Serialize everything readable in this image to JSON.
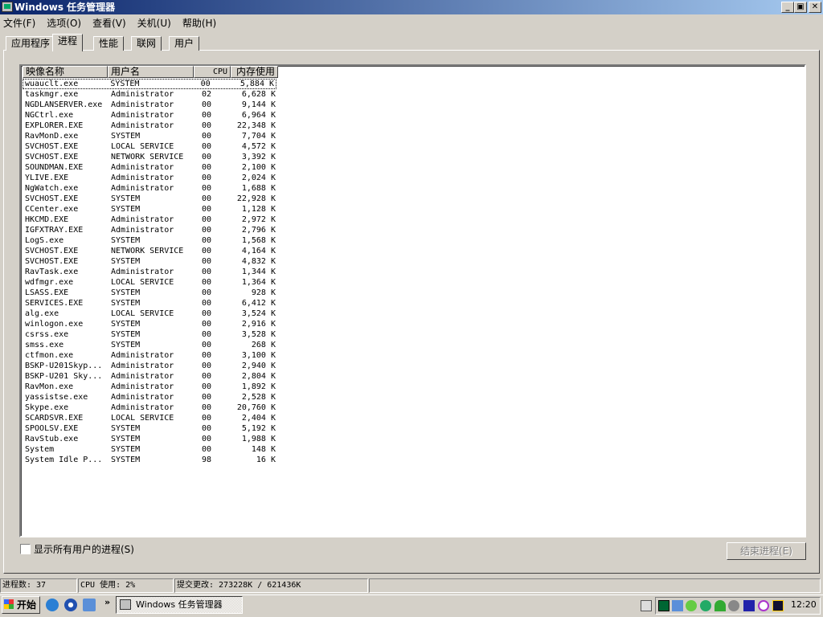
{
  "window": {
    "title": "Windows 任务管理器",
    "minimize": "_",
    "restore": "▣",
    "close": "✕"
  },
  "menu": [
    "文件(F)",
    "选项(O)",
    "查看(V)",
    "关机(U)",
    "帮助(H)"
  ],
  "tabs": [
    "应用程序",
    "进程",
    "性能",
    "联网",
    "用户"
  ],
  "active_tab": 1,
  "columns": [
    "映像名称",
    "用户名",
    "CPU",
    "内存使用"
  ],
  "processes": [
    [
      "wuauclt.exe",
      "SYSTEM",
      "00",
      "5,884 K"
    ],
    [
      "taskmgr.exe",
      "Administrator",
      "02",
      "6,628 K"
    ],
    [
      "NGDLANSERVER.exe",
      "Administrator",
      "00",
      "9,144 K"
    ],
    [
      "NGCtrl.exe",
      "Administrator",
      "00",
      "6,964 K"
    ],
    [
      "EXPLORER.EXE",
      "Administrator",
      "00",
      "22,348 K"
    ],
    [
      "RavMonD.exe",
      "SYSTEM",
      "00",
      "7,704 K"
    ],
    [
      "SVCHOST.EXE",
      "LOCAL SERVICE",
      "00",
      "4,572 K"
    ],
    [
      "SVCHOST.EXE",
      "NETWORK SERVICE",
      "00",
      "3,392 K"
    ],
    [
      "SOUNDMAN.EXE",
      "Administrator",
      "00",
      "2,100 K"
    ],
    [
      "YLIVE.EXE",
      "Administrator",
      "00",
      "2,024 K"
    ],
    [
      "NgWatch.exe",
      "Administrator",
      "00",
      "1,688 K"
    ],
    [
      "SVCHOST.EXE",
      "SYSTEM",
      "00",
      "22,928 K"
    ],
    [
      "CCenter.exe",
      "SYSTEM",
      "00",
      "1,128 K"
    ],
    [
      "HKCMD.EXE",
      "Administrator",
      "00",
      "2,972 K"
    ],
    [
      "IGFXTRAY.EXE",
      "Administrator",
      "00",
      "2,796 K"
    ],
    [
      "LogS.exe",
      "SYSTEM",
      "00",
      "1,568 K"
    ],
    [
      "SVCHOST.EXE",
      "NETWORK SERVICE",
      "00",
      "4,164 K"
    ],
    [
      "SVCHOST.EXE",
      "SYSTEM",
      "00",
      "4,832 K"
    ],
    [
      "RavTask.exe",
      "Administrator",
      "00",
      "1,344 K"
    ],
    [
      "wdfmgr.exe",
      "LOCAL SERVICE",
      "00",
      "1,364 K"
    ],
    [
      "LSASS.EXE",
      "SYSTEM",
      "00",
      "928 K"
    ],
    [
      "SERVICES.EXE",
      "SYSTEM",
      "00",
      "6,412 K"
    ],
    [
      "alg.exe",
      "LOCAL SERVICE",
      "00",
      "3,524 K"
    ],
    [
      "winlogon.exe",
      "SYSTEM",
      "00",
      "2,916 K"
    ],
    [
      "csrss.exe",
      "SYSTEM",
      "00",
      "3,528 K"
    ],
    [
      "smss.exe",
      "SYSTEM",
      "00",
      "268 K"
    ],
    [
      "ctfmon.exe",
      "Administrator",
      "00",
      "3,100 K"
    ],
    [
      "BSKP-U201Skyp...",
      "Administrator",
      "00",
      "2,940 K"
    ],
    [
      "BSKP-U201 Sky...",
      "Administrator",
      "00",
      "2,804 K"
    ],
    [
      "RavMon.exe",
      "Administrator",
      "00",
      "1,892 K"
    ],
    [
      "yassistse.exe",
      "Administrator",
      "00",
      "2,528 K"
    ],
    [
      "Skype.exe",
      "Administrator",
      "00",
      "20,760 K"
    ],
    [
      "SCARDSVR.EXE",
      "LOCAL SERVICE",
      "00",
      "2,404 K"
    ],
    [
      "SPOOLSV.EXE",
      "SYSTEM",
      "00",
      "5,192 K"
    ],
    [
      "RavStub.exe",
      "SYSTEM",
      "00",
      "1,988 K"
    ],
    [
      "System",
      "SYSTEM",
      "00",
      "148 K"
    ],
    [
      "System Idle P...",
      "SYSTEM",
      "98",
      "16 K"
    ]
  ],
  "show_all_users": {
    "label": "显示所有用户的进程(S)",
    "checked": false
  },
  "end_process": "结束进程(E)",
  "status": {
    "processes": "进程数: 37",
    "cpu": "CPU 使用: 2%",
    "commit": "提交更改: 273228K / 621436K"
  },
  "taskbar": {
    "start": "开始",
    "task": "Windows 任务管理器",
    "chevron": "»",
    "clock": "12:20"
  }
}
